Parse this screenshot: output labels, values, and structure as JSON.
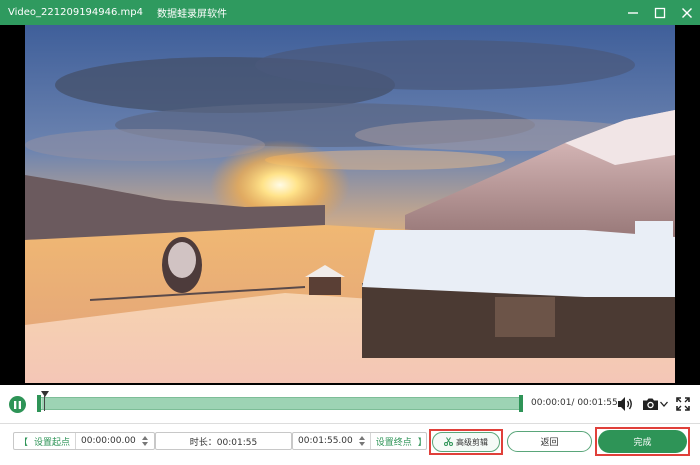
{
  "window": {
    "file_name": "Video_221209194946.mp4",
    "app_name": "数据蛙录屏软件",
    "controls": {
      "minimize": "minimize-icon",
      "maximize": "maximize-icon",
      "close": "close-icon"
    }
  },
  "player": {
    "current_time": "00:00:01",
    "total_time": "00:01:55",
    "timecode_display": "00:00:01/ 00:01:55",
    "progress_fraction": 0.009,
    "icons": {
      "play_pause": "pause-icon",
      "volume": "volume-icon",
      "snapshot": "camera-icon",
      "dropdown": "chevron-down-icon",
      "fullscreen": "fullscreen-icon"
    }
  },
  "trim": {
    "set_start_label": "设置起点",
    "start_time": "00:00:00.00",
    "duration_label": "时长：00:01:55",
    "end_time": "00:01:55.00",
    "set_end_label": "设置终点"
  },
  "actions": {
    "advanced_cut_label": "高级剪辑",
    "back_label": "返回",
    "done_label": "完成"
  },
  "colors": {
    "accent": "#2f9a5f",
    "highlight": "#e0403a"
  }
}
